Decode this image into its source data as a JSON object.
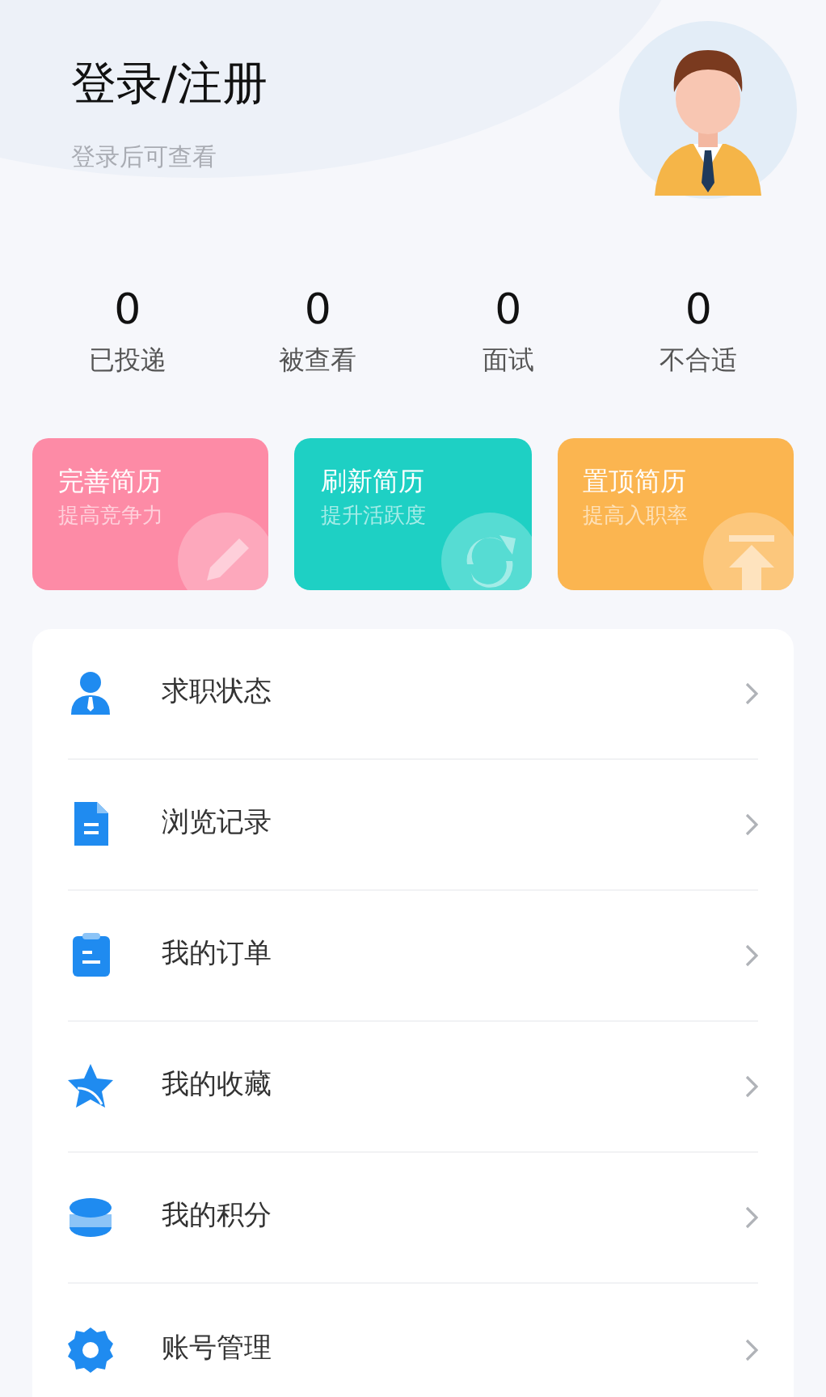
{
  "header": {
    "title": "登录/注册",
    "subtitle": "登录后可查看"
  },
  "stats": [
    {
      "value": "0",
      "label": "已投递"
    },
    {
      "value": "0",
      "label": "被查看"
    },
    {
      "value": "0",
      "label": "面试"
    },
    {
      "value": "0",
      "label": "不合适"
    }
  ],
  "action_cards": [
    {
      "title": "完善简历",
      "subtitle": "提高竞争力",
      "color": "#fd8ba6",
      "kind": "edit"
    },
    {
      "title": "刷新简历",
      "subtitle": "提升活跃度",
      "color": "#1ed0c4",
      "kind": "refresh"
    },
    {
      "title": "置顶简历",
      "subtitle": "提高入职率",
      "color": "#fbb550",
      "kind": "top"
    }
  ],
  "menu": [
    {
      "label": "求职状态",
      "kind": "person"
    },
    {
      "label": "浏览记录",
      "kind": "document"
    },
    {
      "label": "我的订单",
      "kind": "clipboard"
    },
    {
      "label": "我的收藏",
      "kind": "star"
    },
    {
      "label": "我的积分",
      "kind": "coins"
    },
    {
      "label": "账号管理",
      "kind": "gear"
    }
  ]
}
